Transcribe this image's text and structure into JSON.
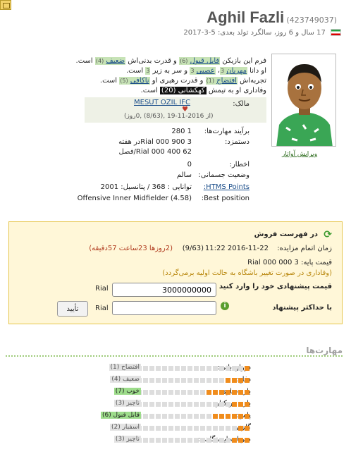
{
  "header": {
    "name": "Aghil Fazli",
    "id": "(423749037)",
    "subline": "17 سال و 6 روز، سالگرد تولد بعدی: 5-3-2017"
  },
  "description": {
    "l1a": "فرم این بازیکن",
    "form": "قابل قبول",
    "form_n": "(6)",
    "l1b": "و قدرت بدنی‌اش",
    "stamina": "ضعیف",
    "stamina_n": "(4)",
    "l1c": "است.",
    "l2a": "او دانا",
    "p1": "مهربان",
    "p1n": "3",
    "p2": "عصبی",
    "p2n": "3",
    "l2b": "و سر به زیر",
    "p3n": "3",
    "l2c": "است.",
    "l3a": "تجربه‌اش",
    "exp": "افتضاح",
    "exp_n": "(1)",
    "l3b": "و قدرت رهبری او",
    "lead": "ناکافی",
    "lead_n": "(5)",
    "l3c": "است.",
    "l4a": "وفاداری او به تیمش",
    "loyalty": "کهکشانی",
    "loyalty_n": "(20)",
    "l4b": "است."
  },
  "owner": {
    "label": "مالک:",
    "club": "MESUT OZIL IFC",
    "since": "(از 2016-11-19 ,(8/63) ,0روز)"
  },
  "stats": [
    {
      "label": "برآیند مهارت‌ها:",
      "value": "1 280"
    },
    {
      "label": "دستمزد:",
      "value": "3 900 000 Rialدر هفته"
    },
    {
      "label": "",
      "value": "62 400 000 Rial/فصل"
    },
    {
      "label": "اخطار:",
      "value": "0"
    },
    {
      "label": "وضعیت جسمانی:",
      "value": "سالم"
    },
    {
      "label": "HTMS Points:",
      "value": "توانایی : 368 / پتانسیل: 2001"
    },
    {
      "label": "Best position:",
      "value": "Offensive Inner Midfielder (4.58)"
    }
  ],
  "avatar": {
    "edit_link": "ویرایش آواتار"
  },
  "sale": {
    "title": "در فهرست فروش",
    "deadline_label": "زمان اتمام مزایده:",
    "deadline": "2016-11-22 11:22",
    "deadline_week": "(9/63)",
    "remaining": "(2روزها 23ساعت 57دقیقه)",
    "base_price": "قیمت پایه: 3 000 000 Rial",
    "loyalty_note": "(وفاداری در صورت تغییر باشگاه به حالت اولیه برمی‌گردد)",
    "offer_label": "قیمت پیشنهادی خود را وارد کنید",
    "offer_value": "3000000000",
    "currency": "Rial",
    "max_label": "با حداکثر پیشنهاد",
    "max_value": "",
    "submit": "تأیید"
  },
  "skills_title": "مهارت‌ها",
  "skills": [
    {
      "label": "دروازه‌بانی:",
      "level": 1,
      "word": "افتضاح",
      "n": "(1)",
      "tag": "grey"
    },
    {
      "label": "دفاع:",
      "level": 4,
      "word": "ضعیف",
      "n": "(4)",
      "tag": "grey"
    },
    {
      "label": "بازی‌سازی:",
      "level": 7,
      "word": "خوب",
      "n": "(7)",
      "tag": "green"
    },
    {
      "label": "بازی در کنار:",
      "level": 3,
      "word": "ناچیز",
      "n": "(3)",
      "tag": "grey"
    },
    {
      "label": "پاس:",
      "level": 6,
      "word": "قابل قبول",
      "n": "(6)",
      "tag": "green"
    },
    {
      "label": "گلزنی:",
      "level": 2,
      "word": "اسفبار",
      "n": "(2)",
      "tag": "grey"
    },
    {
      "label": "ضربات ایستگاهی:",
      "level": 3,
      "word": "ناچیز",
      "n": "(3)",
      "tag": "grey"
    }
  ]
}
